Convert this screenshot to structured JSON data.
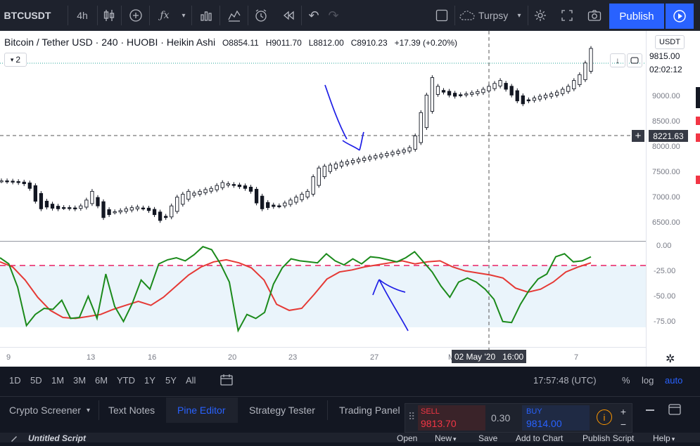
{
  "toolbar": {
    "symbol": "BTCUSDT",
    "interval": "4h",
    "indicator_label": "Turpsy",
    "publish_label": "Publish",
    "accent": "#2962ff"
  },
  "legend": {
    "title": "Bitcoin / Tether USD · 240 · HUOBI · Heikin Ashi",
    "open": "O8854.11",
    "high": "H9011.70",
    "low": "L8812.00",
    "close": "C8910.23",
    "change": "+17.39 (+0.20%)",
    "study_count": "2"
  },
  "price_axis": {
    "currency": "USDT",
    "labels": [
      "9000.00",
      "8500.00",
      "8000.00",
      "7500.00",
      "7000.00",
      "6500.00"
    ],
    "last_price": "9815.00",
    "countdown": "02:02:12",
    "crosshair_price": "8221.63"
  },
  "osc_axis": {
    "labels": [
      "0.00",
      "-25.00",
      "-50.00",
      "-75.00"
    ]
  },
  "time_axis": {
    "labels": [
      "9",
      "13",
      "16",
      "20",
      "23",
      "27",
      "M",
      "7"
    ],
    "crosshair_time": "02 May '20   16:00"
  },
  "timeframes": [
    "1D",
    "5D",
    "1M",
    "3M",
    "6M",
    "YTD",
    "1Y",
    "5Y",
    "All"
  ],
  "status": {
    "clock": "17:57:48 (UTC)",
    "percent": "%",
    "log": "log",
    "auto": "auto"
  },
  "panels": {
    "tabs": [
      "Crypto Screener",
      "Text Notes",
      "Pine Editor",
      "Strategy Tester",
      "Trading Panel"
    ],
    "active": "Pine Editor",
    "script_name": "Untitled Script",
    "menu": [
      "Open",
      "New",
      "Save",
      "Add to Chart",
      "Publish Script",
      "Help"
    ]
  },
  "trade": {
    "sell_label": "SELL",
    "sell_price": "9813.70",
    "spread": "0.30",
    "buy_label": "BUY",
    "buy_price": "9814.00",
    "sell_color": "#f23645",
    "buy_color": "#2962ff"
  },
  "chart_data": {
    "type": "candlestick",
    "ylim": [
      6300,
      9900
    ],
    "candles_close": [
      7330,
      7320,
      7310,
      7300,
      7280,
      7200,
      6980,
      6850,
      6880,
      6860,
      6850,
      6870,
      6860,
      6850,
      6900,
      7000,
      7150,
      6900,
      6700,
      6750,
      6800,
      6820,
      6850,
      6870,
      6880,
      6860,
      6820,
      6750,
      6650,
      6700,
      6900,
      7050,
      7100,
      7150,
      7120,
      7150,
      7180,
      7200,
      7250,
      7300,
      7280,
      7250,
      7230,
      7200,
      7150,
      6950,
      6850,
      6870,
      6890,
      6900,
      6950,
      7000,
      7050,
      7100,
      7150,
      7400,
      7550,
      7580,
      7600,
      7620,
      7650,
      7660,
      7680,
      7700,
      7720,
      7740,
      7760,
      7780,
      7800,
      7820,
      7840,
      7860,
      7900,
      8100,
      8500,
      8800,
      9100,
      8950,
      8850,
      8800,
      8780,
      8800,
      8820,
      8840,
      8860,
      8900,
      8950,
      9000,
      9050,
      8900,
      8800,
      8700,
      8650,
      8700,
      8750,
      8780,
      8800,
      8820,
      8850,
      8900,
      8950,
      9050,
      9150,
      9350,
      9600
    ],
    "oscillator": {
      "range": [
        -100,
        0
      ],
      "fast": [
        -16,
        -22,
        -45,
        -83,
        -72,
        -66,
        -67,
        -58,
        -76,
        -75,
        -54,
        -76,
        -32,
        -64,
        -79,
        -61,
        -38,
        -47,
        -22,
        -18,
        -16,
        -19,
        -13,
        -5,
        -8,
        -22,
        -40,
        -88,
        -72,
        -76,
        -70,
        -42,
        -26,
        -17,
        -19,
        -20,
        -21,
        -12,
        -19,
        -23,
        -17,
        -22,
        -15,
        -16,
        -18,
        -20,
        -16,
        -10,
        -20,
        -30,
        -44,
        -55,
        -40,
        -36,
        -40,
        -47,
        -57,
        -79,
        -80,
        -62,
        -48,
        -37,
        -32,
        -15,
        -12,
        -20,
        -19,
        -15
      ],
      "slow": [
        -20,
        -25,
        -38,
        -55,
        -68,
        -75,
        -76,
        -74,
        -72,
        -67,
        -63,
        -59,
        -63,
        -55,
        -44,
        -33,
        -25,
        -20,
        -18,
        -21,
        -26,
        -38,
        -62,
        -68,
        -66,
        -52,
        -37,
        -30,
        -28,
        -25,
        -23,
        -21,
        -19,
        -22,
        -20,
        -19,
        -25,
        -29,
        -31,
        -33,
        -36,
        -46,
        -50,
        -47,
        -40,
        -30,
        -25,
        -21
      ]
    },
    "levels": {
      "dashed": -25,
      "band": [
        -25,
        -80
      ]
    }
  }
}
